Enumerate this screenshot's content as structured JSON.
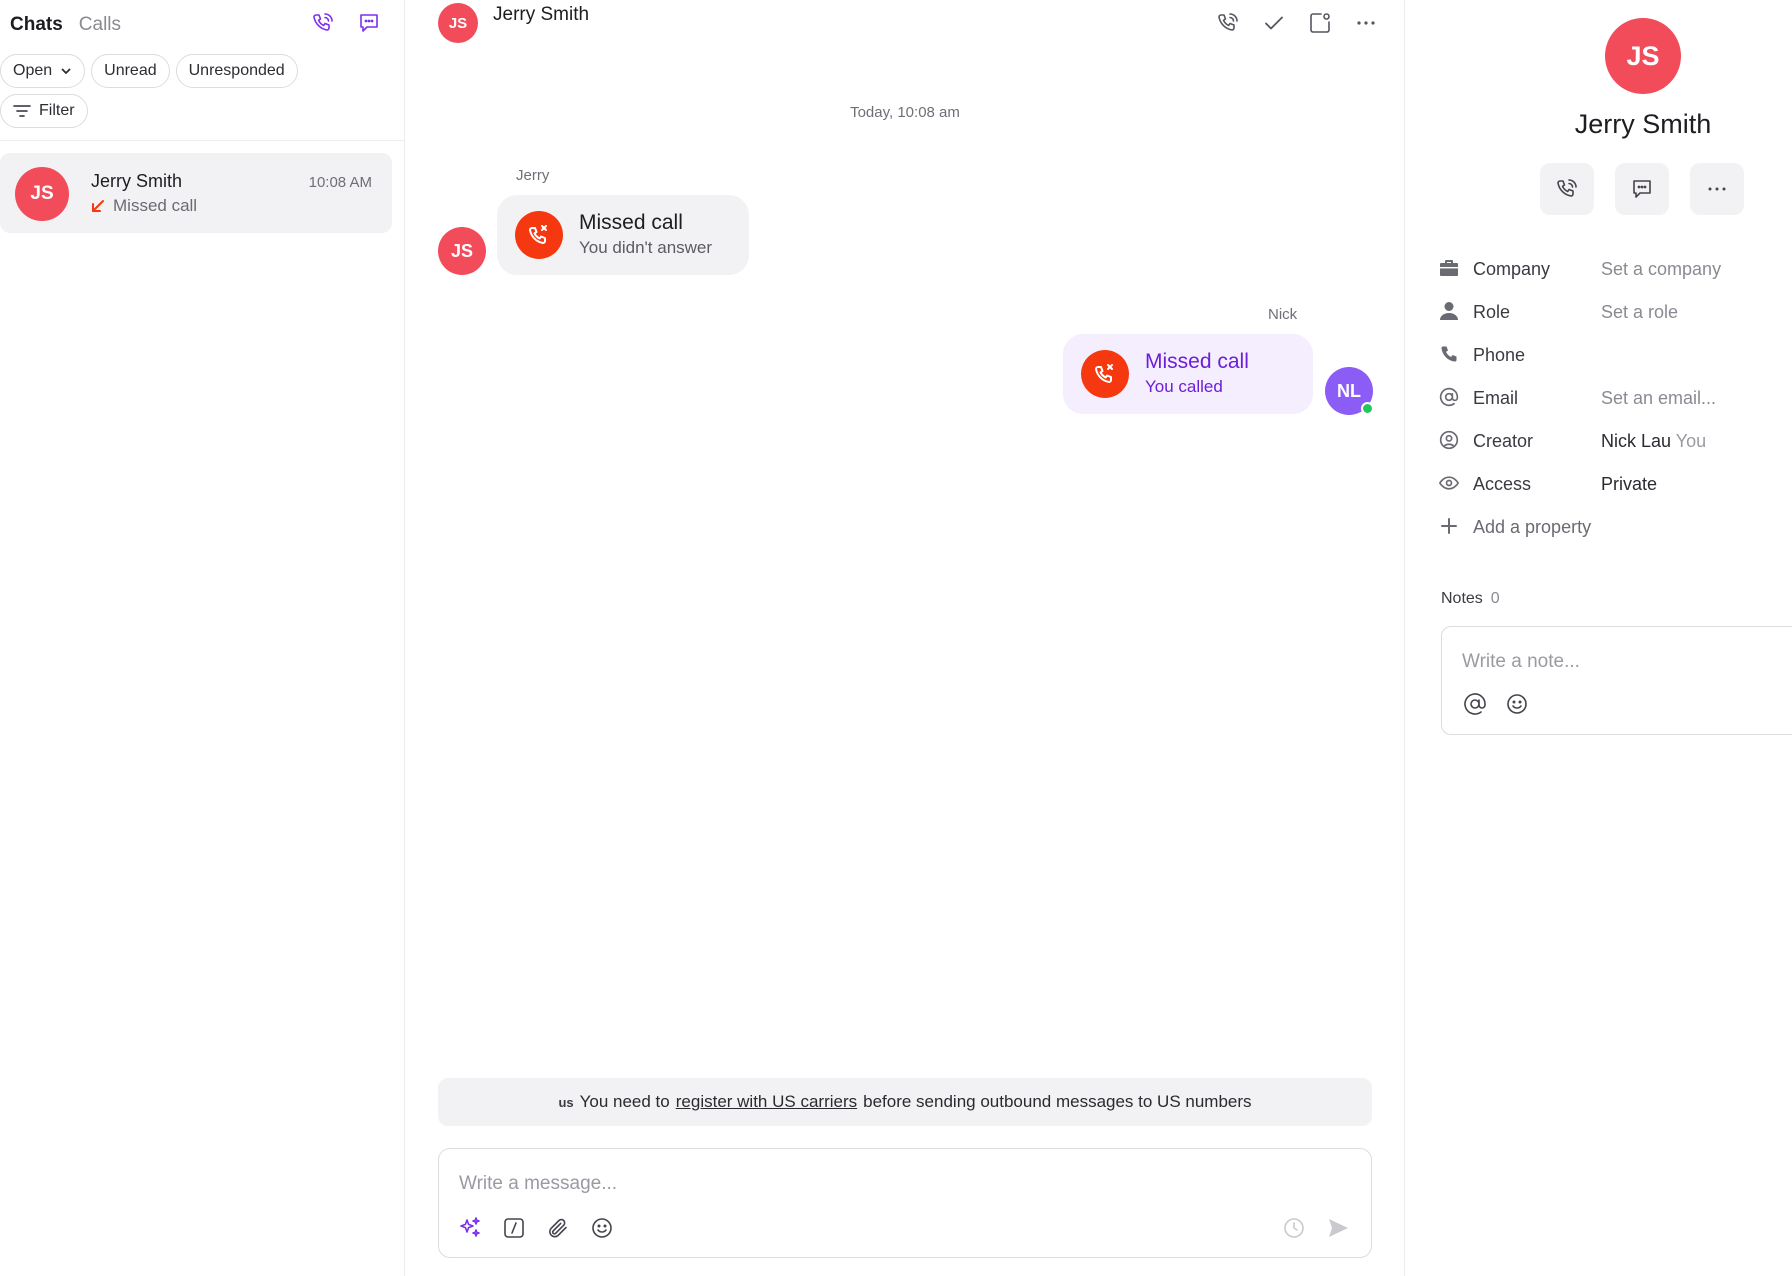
{
  "sidebar": {
    "tabs": [
      {
        "label": "Chats"
      },
      {
        "label": "Calls"
      }
    ],
    "chips": {
      "open": "Open",
      "unread": "Unread",
      "unresponded": "Unresponded",
      "filter": "Filter"
    },
    "conversations": [
      {
        "initials": "JS",
        "name": "Jerry Smith",
        "time": "10:08 AM",
        "preview": "Missed call"
      }
    ]
  },
  "chat": {
    "header": {
      "initials": "JS",
      "name": "Jerry Smith"
    },
    "day_label": "Today, 10:08 am",
    "messages": [
      {
        "sender": "Jerry",
        "initials": "JS",
        "title": "Missed call",
        "subtitle": "You didn't answer"
      },
      {
        "sender": "Nick",
        "initials": "NL",
        "title": "Missed call",
        "subtitle": "You called"
      }
    ],
    "banner": {
      "flag": "us",
      "prefix": "You need to",
      "link": "register with US carriers",
      "suffix": "before sending outbound messages to US numbers"
    },
    "composer": {
      "placeholder": "Write a message..."
    }
  },
  "contact": {
    "initials": "JS",
    "name": "Jerry Smith",
    "properties": [
      {
        "label": "Company",
        "value": "Set a company"
      },
      {
        "label": "Role",
        "value": "Set a role"
      },
      {
        "label": "Phone",
        "value": ""
      },
      {
        "label": "Email",
        "value": "Set an email..."
      },
      {
        "label": "Creator",
        "value": "Nick Lau",
        "extra": "You"
      },
      {
        "label": "Access",
        "value": "Private"
      }
    ],
    "add_property": "Add a property",
    "notes": {
      "label": "Notes",
      "count": "0",
      "placeholder": "Write a note..."
    }
  },
  "colors": {
    "accent": "#6c1fd6",
    "avatar_red": "#f24c5a",
    "avatar_purple": "#8b5cf6",
    "missed_call": "#f5380f",
    "online": "#22c55e"
  }
}
